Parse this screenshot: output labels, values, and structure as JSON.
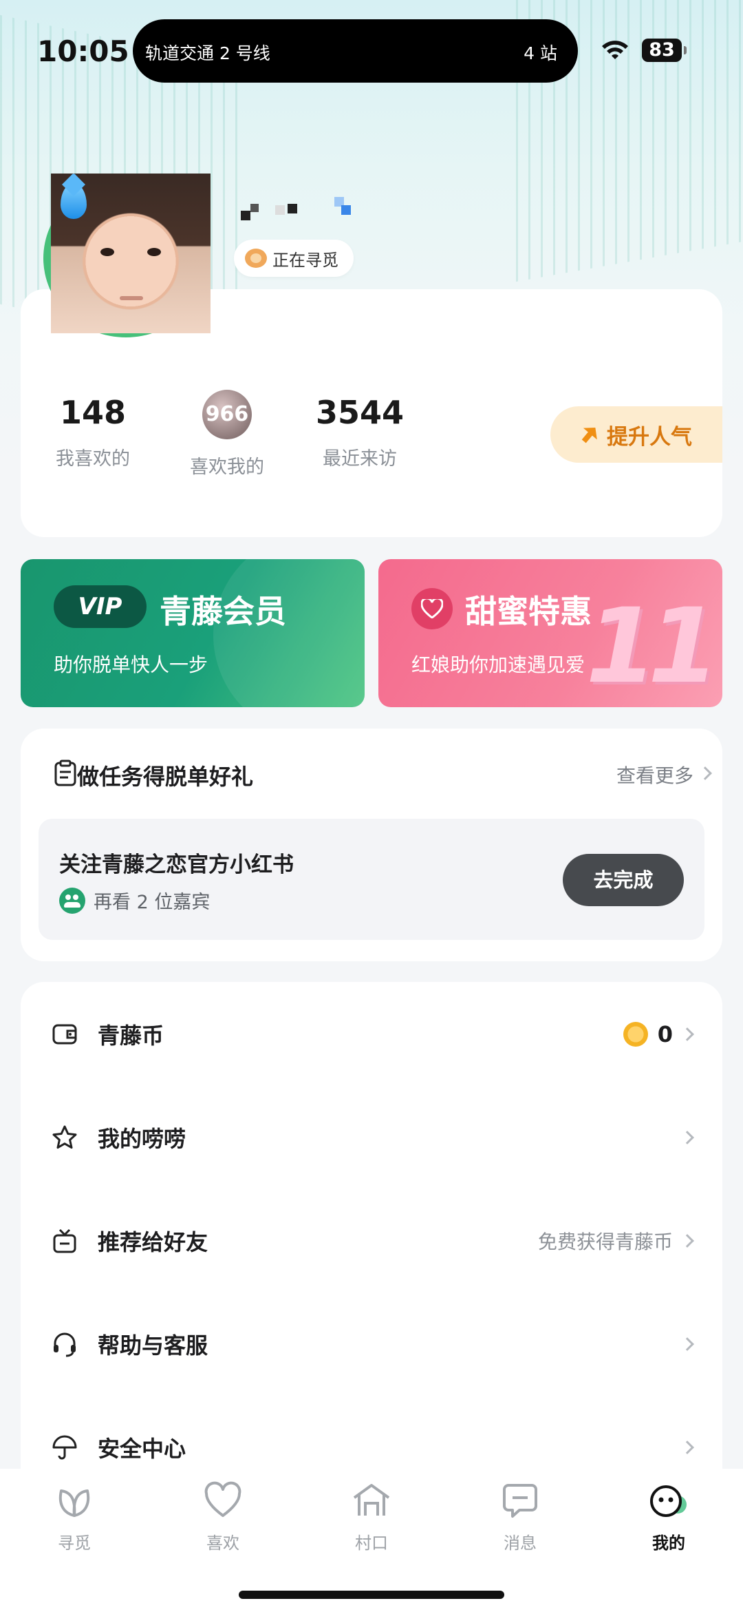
{
  "status_bar": {
    "time": "10:05",
    "live_activity": "轨道交通 2 号线",
    "live_activity_stops": "4 站",
    "battery": "83"
  },
  "profile": {
    "status": "正在寻觅",
    "stats": [
      {
        "value": "148",
        "label": "我喜欢的"
      },
      {
        "value": "966",
        "label": "喜欢我的"
      },
      {
        "value": "3544",
        "label": "最近来访"
      }
    ],
    "boost_label": "提升人气"
  },
  "promos": {
    "vip": {
      "tag": "VIP",
      "title": "青藤会员",
      "subtitle": "助你脱单快人一步"
    },
    "sweet": {
      "title": "甜蜜特惠",
      "subtitle": "红娘助你加速遇见爱",
      "badge": "11"
    }
  },
  "tasks": {
    "title": "做任务得脱单好礼",
    "more": "查看更多",
    "item": {
      "name": "关注青藤之恋官方小红书",
      "reward": "再看 2 位嘉宾",
      "action": "去完成"
    }
  },
  "menu": [
    {
      "label": "青藤币",
      "icon": "wallet-icon",
      "value": "0"
    },
    {
      "label": "我的唠唠",
      "icon": "star-icon",
      "extra": ""
    },
    {
      "label": "推荐给好友",
      "icon": "gift-icon",
      "extra": "免费获得青藤币"
    },
    {
      "label": "帮助与客服",
      "icon": "headset-icon",
      "extra": ""
    },
    {
      "label": "安全中心",
      "icon": "umbrella-icon",
      "extra": ""
    }
  ],
  "tabbar": [
    {
      "label": "寻觅",
      "icon": "leaf-icon"
    },
    {
      "label": "喜欢",
      "icon": "heart-icon"
    },
    {
      "label": "村口",
      "icon": "village-icon"
    },
    {
      "label": "消息",
      "icon": "chat-icon"
    },
    {
      "label": "我的",
      "icon": "me-icon",
      "active": true
    }
  ],
  "colors": {
    "brand_green": "#1a9e74",
    "sweet_pink": "#f46a8d",
    "boost_orange": "#d8780f"
  }
}
